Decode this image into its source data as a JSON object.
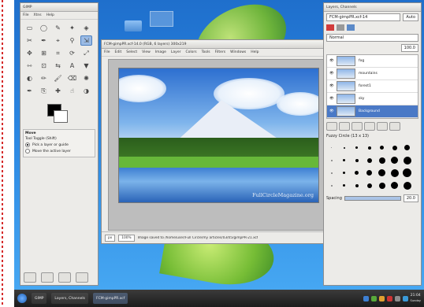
{
  "toolbox": {
    "title": "GIMP",
    "menus": [
      "File",
      "Xtns",
      "Help"
    ],
    "tools": [
      "rect-select",
      "ellipse-select",
      "free-select",
      "fuzzy-select",
      "color-select",
      "scissors",
      "paths",
      "color-picker",
      "zoom",
      "measure",
      "move",
      "align",
      "crop",
      "rotate",
      "scale",
      "shear",
      "perspective",
      "flip",
      "text",
      "bucket-fill",
      "blend",
      "pencil",
      "paintbrush",
      "eraser",
      "airbrush",
      "ink",
      "clone",
      "heal",
      "smudge",
      "dodge-burn"
    ],
    "active_tool": 9,
    "options_title": "Move",
    "options_mode_label": "Tool Toggle (Shift)",
    "options_radio_1": "Pick a layer or guide",
    "options_radio_2": "Move the active layer"
  },
  "image_window": {
    "title": "FCM-gimpPR.xcf-14.0 (RGB, 6 layers) 300x219",
    "menus": [
      "File",
      "Edit",
      "Select",
      "View",
      "Image",
      "Layer",
      "Colors",
      "Tools",
      "Filters",
      "Windows",
      "Help"
    ],
    "watermark": "FullCircleMagazine.org",
    "unit": "px",
    "zoom": "100%",
    "status": "Image saved to /home/user/Full Circle/my articles/03/05/gimpPR-21.xcf"
  },
  "layers_dock": {
    "title": "Layers, Channels",
    "image_combo": "FCM-gimpPR.xcf-14",
    "auto_label": "Auto",
    "mode": "Normal",
    "opacity": "100.0",
    "layers": [
      {
        "name": "fog"
      },
      {
        "name": "mountains"
      },
      {
        "name": "forest1"
      },
      {
        "name": "sky"
      },
      {
        "name": "Background"
      }
    ],
    "selected_layer": 4,
    "brushes_title": "Fuzzy Circle (13 x 13)",
    "spacing_label": "Spacing",
    "spacing_value": "20.0"
  },
  "taskbar": {
    "items": [
      "GIMP",
      "Layers, Channels",
      "FCM-gimpPR.xcf"
    ],
    "clock": "21:04",
    "date": "Sunday"
  },
  "colors": {
    "accent": "#4a79c6",
    "desktop": "#2a86e2"
  }
}
